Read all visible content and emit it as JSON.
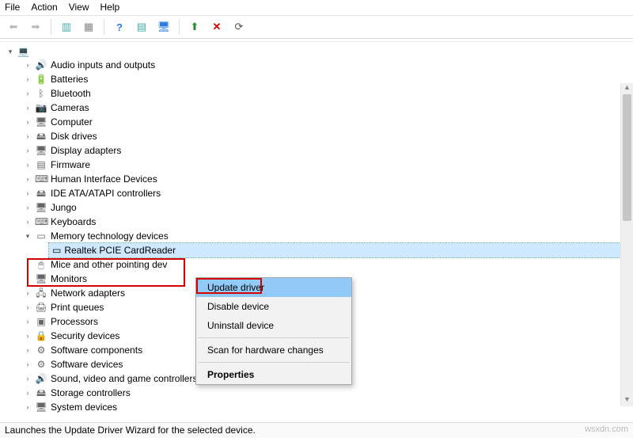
{
  "menubar": {
    "file": "File",
    "action": "Action",
    "view": "View",
    "help": "Help"
  },
  "tree": {
    "root_icon": "💻",
    "categories": [
      {
        "label": "Audio inputs and outputs",
        "icon": "🔊"
      },
      {
        "label": "Batteries",
        "icon": "🔋"
      },
      {
        "label": "Bluetooth",
        "icon": "ᛒ"
      },
      {
        "label": "Cameras",
        "icon": "📷"
      },
      {
        "label": "Computer",
        "icon": "🖥"
      },
      {
        "label": "Disk drives",
        "icon": "🖴"
      },
      {
        "label": "Display adapters",
        "icon": "🖥"
      },
      {
        "label": "Firmware",
        "icon": "▤"
      },
      {
        "label": "Human Interface Devices",
        "icon": "⌨"
      },
      {
        "label": "IDE ATA/ATAPI controllers",
        "icon": "🖴"
      },
      {
        "label": "Jungo",
        "icon": "🖥"
      },
      {
        "label": "Keyboards",
        "icon": "⌨"
      },
      {
        "label": "Memory technology devices",
        "icon": "▭",
        "expanded": true,
        "children": [
          {
            "label": "Realtek PCIE CardReader",
            "icon": "▭",
            "selected": true
          }
        ]
      },
      {
        "label": "Mice and other pointing dev",
        "icon": "🖱"
      },
      {
        "label": "Monitors",
        "icon": "🖥"
      },
      {
        "label": "Network adapters",
        "icon": "🖧"
      },
      {
        "label": "Print queues",
        "icon": "🖨"
      },
      {
        "label": "Processors",
        "icon": "▣"
      },
      {
        "label": "Security devices",
        "icon": "🔒"
      },
      {
        "label": "Software components",
        "icon": "⚙"
      },
      {
        "label": "Software devices",
        "icon": "⚙"
      },
      {
        "label": "Sound, video and game controllers",
        "icon": "🔊"
      },
      {
        "label": "Storage controllers",
        "icon": "🖴"
      },
      {
        "label": "System devices",
        "icon": "🖥"
      }
    ]
  },
  "context_menu": {
    "update": "Update driver",
    "disable": "Disable device",
    "uninstall": "Uninstall device",
    "scan": "Scan for hardware changes",
    "properties": "Properties"
  },
  "statusbar": {
    "text": "Launches the Update Driver Wizard for the selected device.",
    "watermark": "wsxdn.com"
  }
}
